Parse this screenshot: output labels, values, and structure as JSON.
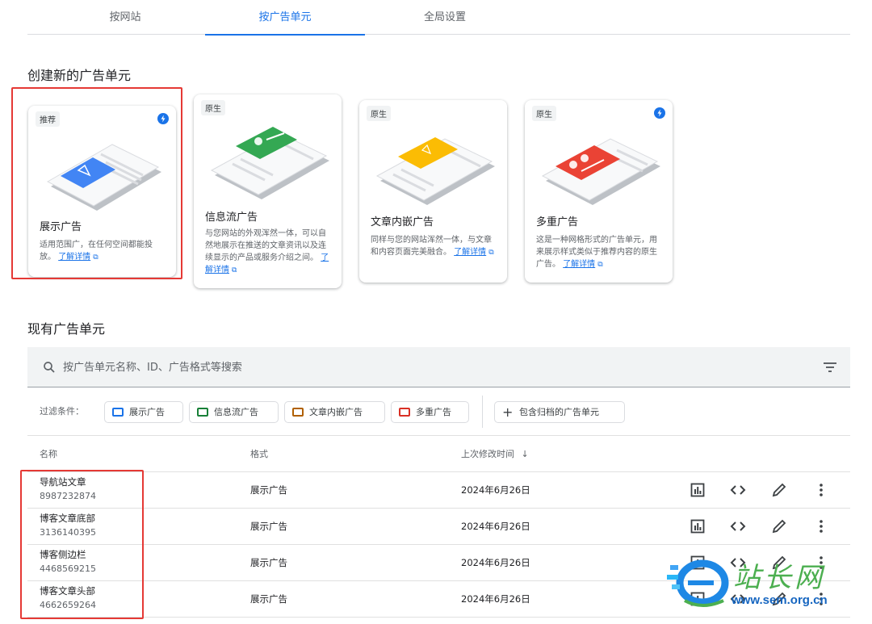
{
  "tabs": [
    {
      "label": "按网站",
      "active": false
    },
    {
      "label": "按广告单元",
      "active": true
    },
    {
      "label": "全局设置",
      "active": false
    }
  ],
  "create_section": {
    "title": "创建新的广告单元",
    "cards": [
      {
        "badge": "推荐",
        "title": "展示广告",
        "desc": "适用范围广，在任何空间都能投放。",
        "link": "了解详情",
        "accent": "#4285f4",
        "flash": true
      },
      {
        "badge": "原生",
        "title": "信息流广告",
        "desc": "与您网站的外观浑然一体，可以自然地展示在推送的文章资讯以及连续显示的产品或服务介绍之间。",
        "link": "了解详情",
        "accent": "#34a853",
        "flash": false
      },
      {
        "badge": "原生",
        "title": "文章内嵌广告",
        "desc": "同样与您的网站浑然一体，与文章和内容页面完美融合。",
        "link": "了解详情",
        "accent": "#fbbc04",
        "flash": false
      },
      {
        "badge": "原生",
        "title": "多重广告",
        "desc": "这是一种网格形式的广告单元，用来展示样式类似于推荐内容的原生广告。",
        "link": "了解详情",
        "accent": "#ea4335",
        "flash": true
      }
    ]
  },
  "existing_section": {
    "title": "现有广告单元",
    "search_placeholder": "按广告单元名称、ID、广告格式等搜索",
    "filter_label": "过滤条件：",
    "filters": [
      {
        "label": "展示广告",
        "color": "#1a73e8"
      },
      {
        "label": "信息流广告",
        "color": "#188038"
      },
      {
        "label": "文章内嵌广告",
        "color": "#b06000"
      },
      {
        "label": "多重广告",
        "color": "#d93025"
      }
    ],
    "archive_chip": "包含归档的广告单元",
    "columns": {
      "name": "名称",
      "format": "格式",
      "modified": "上次修改时间"
    },
    "rows": [
      {
        "name": "导航站文章",
        "id": "8987232874",
        "format": "展示广告",
        "date": "2024年6月26日"
      },
      {
        "name": "博客文章底部",
        "id": "3136140395",
        "format": "展示广告",
        "date": "2024年6月26日"
      },
      {
        "name": "博客侧边栏",
        "id": "4468569215",
        "format": "展示广告",
        "date": "2024年6月26日"
      },
      {
        "name": "博客文章头部",
        "id": "4662659264",
        "format": "展示广告",
        "date": "2024年6月26日"
      }
    ]
  },
  "watermark": {
    "text": "站长网",
    "url": "www.sem.org.cn"
  },
  "icons": [
    "search-icon",
    "filter-list-icon",
    "bar-chart-icon",
    "code-icon",
    "edit-icon",
    "more-vert-icon",
    "open-in-new-icon",
    "flash-icon",
    "sort-arrow-down-icon",
    "add-icon"
  ]
}
